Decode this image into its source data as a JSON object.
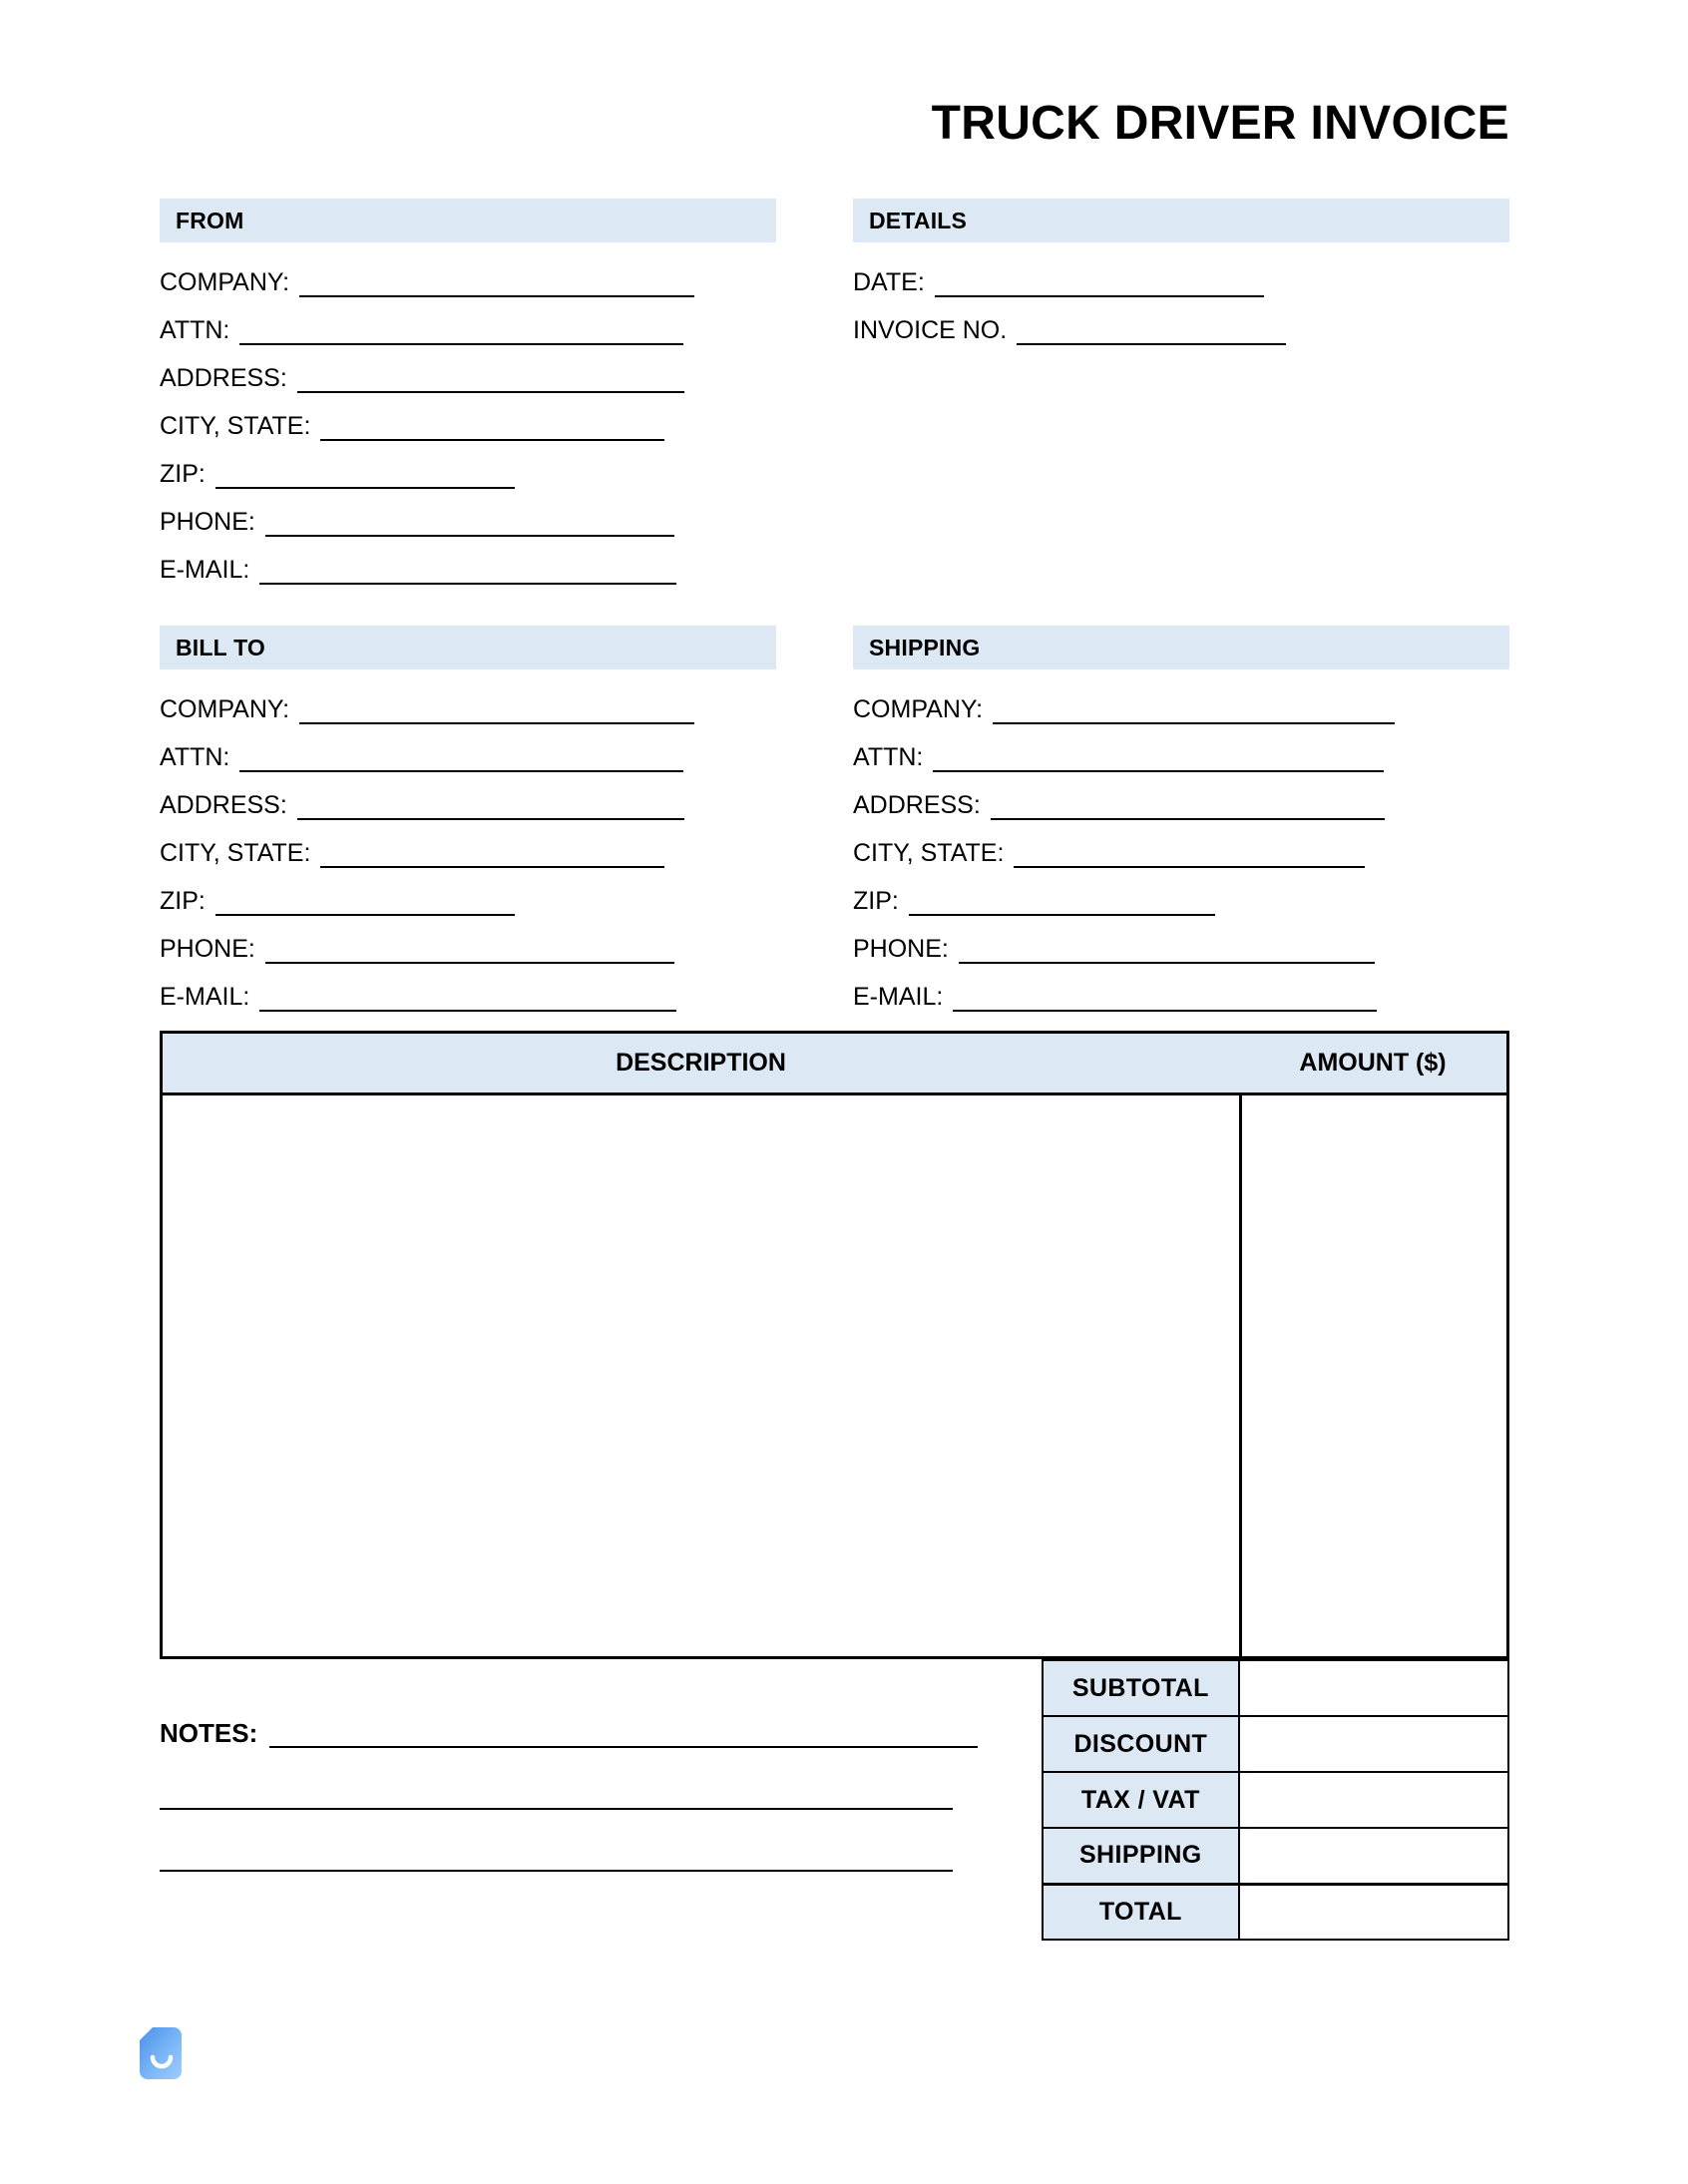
{
  "document": {
    "title": "TRUCK DRIVER INVOICE"
  },
  "sections": {
    "from": {
      "heading": "FROM",
      "fields": [
        {
          "label": "COMPANY:"
        },
        {
          "label": "ATTN:"
        },
        {
          "label": "ADDRESS:"
        },
        {
          "label": "CITY, STATE:"
        },
        {
          "label": "ZIP:"
        },
        {
          "label": "PHONE:"
        },
        {
          "label": "E-MAIL:"
        }
      ]
    },
    "details": {
      "heading": "DETAILS",
      "fields": [
        {
          "label": "DATE:"
        },
        {
          "label": "INVOICE NO."
        }
      ]
    },
    "bill_to": {
      "heading": "BILL TO",
      "fields": [
        {
          "label": "COMPANY:"
        },
        {
          "label": "ATTN:"
        },
        {
          "label": "ADDRESS:"
        },
        {
          "label": "CITY, STATE:"
        },
        {
          "label": "ZIP:"
        },
        {
          "label": "PHONE:"
        },
        {
          "label": "E-MAIL:"
        }
      ]
    },
    "shipping": {
      "heading": "SHIPPING",
      "fields": [
        {
          "label": "COMPANY:"
        },
        {
          "label": "ATTN:"
        },
        {
          "label": "ADDRESS:"
        },
        {
          "label": "CITY, STATE:"
        },
        {
          "label": "ZIP:"
        },
        {
          "label": "PHONE:"
        },
        {
          "label": "E-MAIL:"
        }
      ]
    }
  },
  "line_items": {
    "columns": {
      "description": "DESCRIPTION",
      "amount": "AMOUNT ($)"
    },
    "rows": []
  },
  "totals": {
    "rows": [
      {
        "label": "SUBTOTAL",
        "value": ""
      },
      {
        "label": "DISCOUNT",
        "value": ""
      },
      {
        "label": "TAX / VAT",
        "value": ""
      },
      {
        "label": "SHIPPING",
        "value": ""
      },
      {
        "label": "TOTAL",
        "value": ""
      }
    ]
  },
  "notes": {
    "label": "NOTES:",
    "value": "",
    "extra_lines": 2
  },
  "logo": {
    "icon": "document-smile-logo-icon",
    "color_light": "#8fc4fb",
    "color_dark": "#4a90e8"
  },
  "colors": {
    "band_background": "#dde8f5",
    "rule": "#000000",
    "page_background": "#ffffff"
  }
}
